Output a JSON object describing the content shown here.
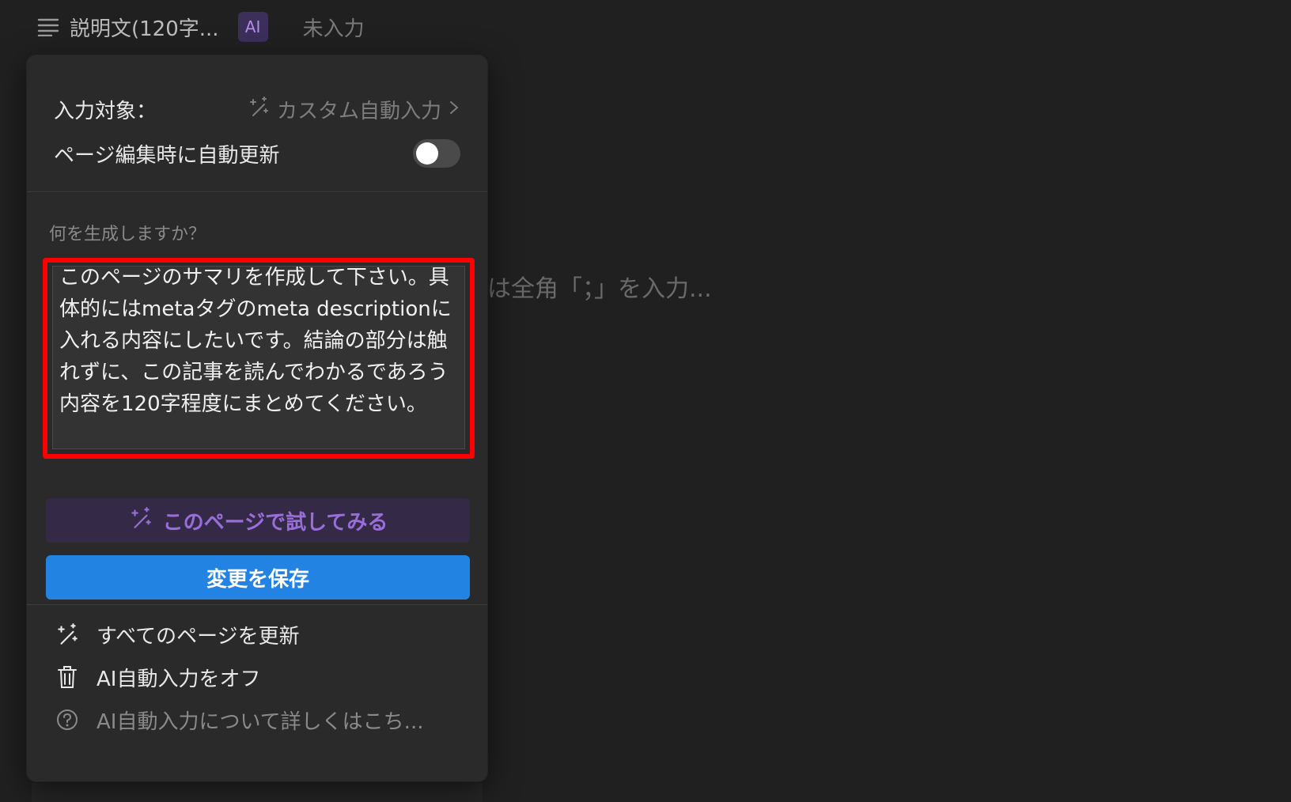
{
  "property": {
    "name": "説明文(120字...",
    "ai_badge": "AI",
    "value": "未入力"
  },
  "background": {
    "placeholder_fragment": "は全角「；」を入力..."
  },
  "popup": {
    "target_label": "入力対象：",
    "target_value": "カスタム自動入力",
    "auto_update_label": "ページ編集時に自動更新",
    "auto_update_enabled": false,
    "prompt_section_label": "何を生成しますか？",
    "prompt_text": "このページのサマリを作成して下さい。具体的にはmetaタグのmeta descriptionに入れる内容にしたいです。結論の部分は触れずに、この記事を読んでわかるであろう内容を120字程度にまとめてください。",
    "try_button": "このページで試してみる",
    "save_button": "変更を保存",
    "menu": [
      {
        "label": "すべてのページを更新",
        "icon": "sparkles-icon"
      },
      {
        "label": "AI自動入力をオフ",
        "icon": "trash-icon"
      },
      {
        "label": "AI自動入力について詳しくはこち...",
        "icon": "help-icon"
      }
    ]
  },
  "colors": {
    "accent_blue": "#2383e2",
    "ai_purple": "#9a6ed9",
    "highlight_red": "#ff0000"
  }
}
